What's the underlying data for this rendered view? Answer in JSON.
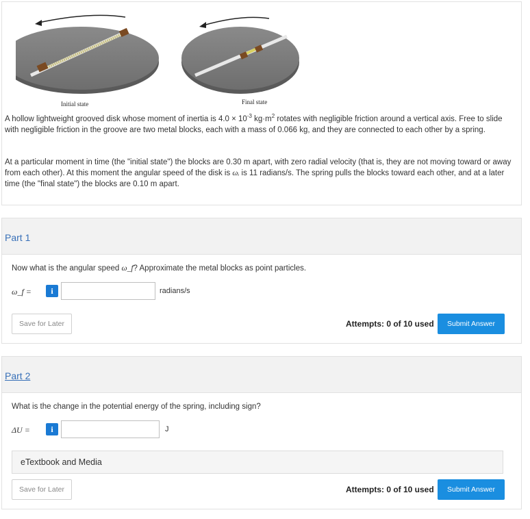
{
  "figure": {
    "caption_initial": "Initial state",
    "caption_final": "Final state"
  },
  "problem": {
    "p1_a": "A hollow lightweight grooved disk whose moment of inertia is ",
    "p1_coef": "4.0 × 10",
    "p1_exp": "-3",
    "p1_unit_a": " kg·m",
    "p1_unit_exp": "2",
    "p1_b": " rotates with negligible friction around a vertical axis. Free to slide with negligible friction in the groove are two metal blocks, each with a mass of 0.066 kg, and they are connected to each other by a spring.",
    "p2_a": "At a particular moment in time (the \"initial state\") the blocks are 0.30 m apart, with zero radial velocity (that is, they are not moving toward or away from each other). At this moment the angular speed of the disk is ",
    "p2_sym": "ωᵢ",
    "p2_b": " is 11 radians/s. The spring pulls the blocks toward each other, and at a later time (the \"final state\") the blocks are 0.10 m apart."
  },
  "part1": {
    "title": "Part 1",
    "question_a": "Now what is the angular speed ",
    "question_sym": "ω_f",
    "question_b": "? Approximate the metal blocks as point particles.",
    "var_label": "ω_f  =",
    "info": "i",
    "answer_value": "",
    "unit": "radians/s",
    "save_label": "Save for Later",
    "attempts": "Attempts: 0 of 10 used",
    "submit_label": "Submit Answer"
  },
  "part2": {
    "title": "Part 2",
    "question": "What is the change in the potential energy of the spring, including sign?",
    "var_label": "ΔU  =",
    "info": "i",
    "answer_value": "",
    "unit": "J",
    "etextbook": "eTextbook and Media",
    "save_label": "Save for Later",
    "attempts": "Attempts: 0 of 10 used",
    "submit_label": "Submit Answer"
  }
}
